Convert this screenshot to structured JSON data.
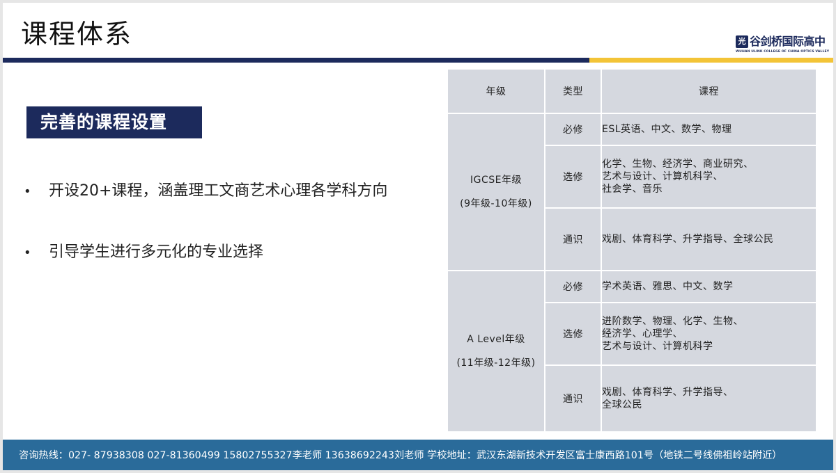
{
  "slide": {
    "title": "课程体系",
    "logo": {
      "mark": "光",
      "name_cn": "谷剑桥国际高中",
      "name_en": "WUHAN ULINK COLLEGE OF CHINA OPTICS VALLEY"
    },
    "section_label": "完善的课程设置",
    "bullets": [
      "开设20+课程，涵盖理工文商艺术心理各学科方向",
      "引导学生进行多元化的专业选择"
    ],
    "bullet_symbol": "•"
  },
  "table": {
    "headers": [
      "年级",
      "类型",
      "课程"
    ],
    "groups": [
      {
        "grade": "IGCSE年级",
        "grade_sub": "(9年级-10年级)",
        "rows": [
          {
            "type": "必修",
            "courses": [
              "ESL英语、中文、数学、物理"
            ]
          },
          {
            "type": "选修",
            "courses": [
              "化学、生物、经济学、商业研究、",
              "艺术与设计、计算机科学、",
              "社会学、音乐"
            ]
          },
          {
            "type": "通识",
            "courses": [
              "戏剧、体育科学、升学指导、全球公民"
            ]
          }
        ]
      },
      {
        "grade": "A Level年级",
        "grade_sub": "(11年级-12年级)",
        "rows": [
          {
            "type": "必修",
            "courses": [
              "学术英语、雅思、中文、数学"
            ]
          },
          {
            "type": "选修",
            "courses": [
              "进阶数学、物理、化学、生物、",
              "经济学、心理学、",
              "艺术与设计、计算机科学"
            ]
          },
          {
            "type": "通识",
            "courses": [
              "戏剧、体育科学、升学指导、",
              "全球公民"
            ]
          }
        ]
      }
    ]
  },
  "footer": {
    "text": "咨询热线：027- 87938308   027-81360499   15802755327李老师   13638692243刘老师    学校地址：武汉东湖新技术开发区富士康西路101号（地铁二号线佛祖岭站附近）"
  },
  "colors": {
    "navy": "#1c2a5c",
    "gold": "#f3c437",
    "footer_blue": "#2a6b9a",
    "table_bg": "#d5d8df"
  }
}
